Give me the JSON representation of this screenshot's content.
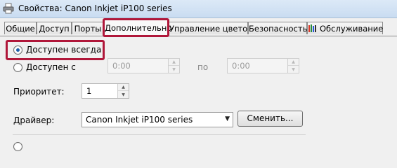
{
  "window": {
    "title": "Свойства: Canon Inkjet iP100 series"
  },
  "tabs": [
    {
      "label": "Общие"
    },
    {
      "label": "Доступ"
    },
    {
      "label": "Порты"
    },
    {
      "label": "Дополнительно",
      "active": true
    },
    {
      "label": "Управление цветом"
    },
    {
      "label": "Безопасность"
    },
    {
      "label": "Обслуживание"
    }
  ],
  "availability": {
    "always_label": "Доступен всегда",
    "from_label": "Доступен с",
    "from_time": "0:00",
    "to_label": "по",
    "to_time": "0:00"
  },
  "priority": {
    "label": "Приоритет:",
    "value": "1"
  },
  "driver": {
    "label": "Драйвер:",
    "value": "Canon Inkjet iP100 series",
    "change_button": "Сменить..."
  },
  "colors": {
    "highlight": "#b0173a",
    "radio_selected": "#1c5faa"
  }
}
